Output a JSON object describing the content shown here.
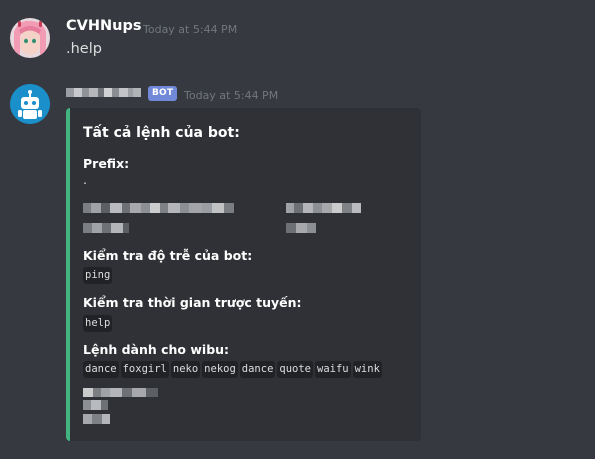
{
  "message1": {
    "username": "CVHNups",
    "timestamp": "Today at 5:44 PM",
    "text": ".help"
  },
  "message2": {
    "badge": "BOT",
    "timestamp": "Today at 5:44 PM",
    "embed": {
      "title": "Tất cả lệnh của bot:",
      "accent_color": "#43b581",
      "prefix_label": "Prefix:",
      "prefix_value": ".",
      "ping_label": "Kiểm tra độ trễ của bot:",
      "ping_cmd": "ping",
      "help_label": "Kiểm tra thời gian trược tuyến:",
      "help_cmd": "help",
      "wibu_label": "Lệnh dành cho wibu:",
      "wibu_cmds": [
        "dance",
        "foxgirl",
        "neko",
        "nekog",
        "dance",
        "quote",
        "waifu",
        "wink"
      ]
    }
  },
  "colors": {
    "background": "#36393f",
    "embed_bg": "#2f3136",
    "bot_badge": "#7289da",
    "timestamp": "#72767d"
  }
}
